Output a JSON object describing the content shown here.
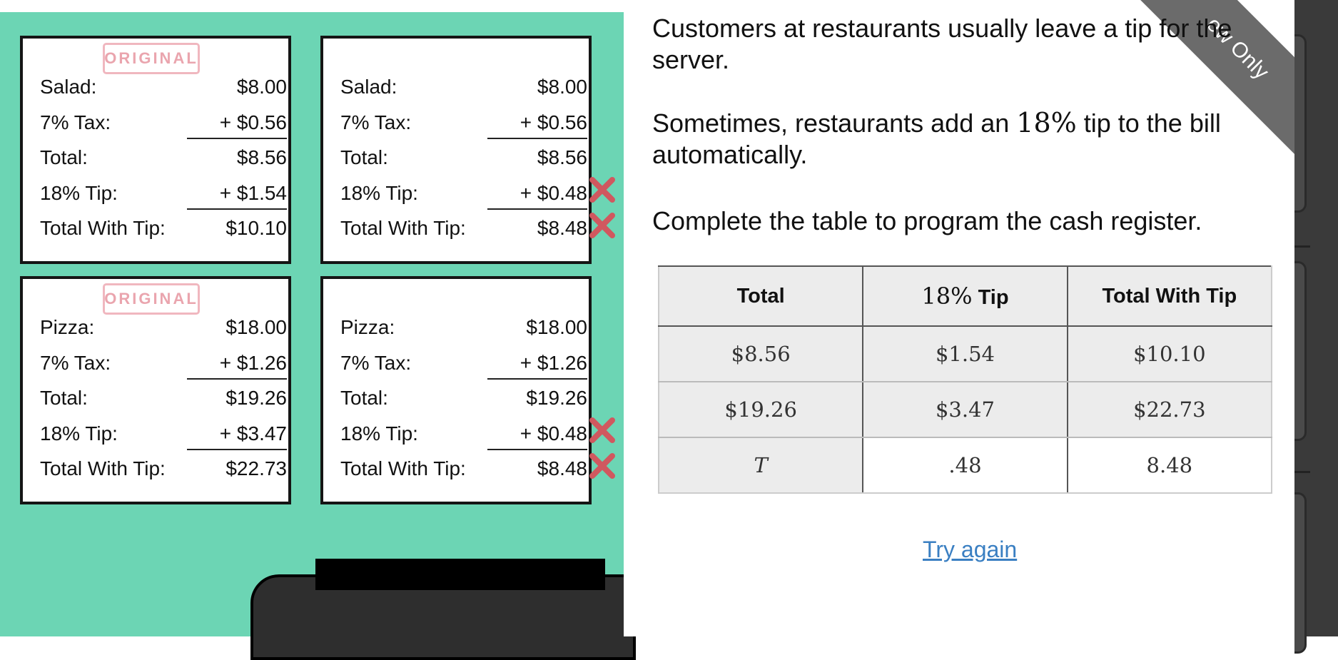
{
  "receipts": [
    {
      "stamp": "ORIGINAL",
      "rows": [
        {
          "label": "Salad:",
          "value": "$8.00"
        },
        {
          "label": "7% Tax:",
          "value": "+ $0.56"
        },
        {
          "label": "Total:",
          "value": "$8.56"
        },
        {
          "label": "18% Tip:",
          "value": "+ $1.54"
        },
        {
          "label": "Total With Tip:",
          "value": "$10.10"
        }
      ]
    },
    {
      "stamp": "",
      "rows": [
        {
          "label": "Salad:",
          "value": "$8.00"
        },
        {
          "label": "7% Tax:",
          "value": "+ $0.56"
        },
        {
          "label": "Total:",
          "value": "$8.56"
        },
        {
          "label": "18% Tip:",
          "value": "+ $0.48"
        },
        {
          "label": "Total With Tip:",
          "value": "$8.48"
        }
      ]
    },
    {
      "stamp": "ORIGINAL",
      "rows": [
        {
          "label": "Pizza:",
          "value": "$18.00"
        },
        {
          "label": "7% Tax:",
          "value": "+ $1.26"
        },
        {
          "label": "Total:",
          "value": "$19.26"
        },
        {
          "label": "18% Tip:",
          "value": "+ $3.47"
        },
        {
          "label": "Total With Tip:",
          "value": "$22.73"
        }
      ]
    },
    {
      "stamp": "",
      "rows": [
        {
          "label": "Pizza:",
          "value": "$18.00"
        },
        {
          "label": "7% Tax:",
          "value": "+ $1.26"
        },
        {
          "label": "Total:",
          "value": "$19.26"
        },
        {
          "label": "18% Tip:",
          "value": "+ $0.48"
        },
        {
          "label": "Total With Tip:",
          "value": "$8.48"
        }
      ]
    }
  ],
  "wrong_mark_color": "#d0585f",
  "ribbon": "ew Only",
  "paragraphs": {
    "p1": "Customers at restaurants usually leave a tip for the server.",
    "p2_before": "Sometimes, restaurants add an ",
    "p2_math": "18%",
    "p2_after": " tip to the bill automatically.",
    "p3": "Complete the table to program the cash register."
  },
  "table": {
    "headers": {
      "total": "Total",
      "tip_math": "18%",
      "tip_word": "Tip",
      "total_with_tip": "Total With Tip"
    },
    "rows": [
      [
        "$8.56",
        "$1.54",
        "$10.10"
      ],
      [
        "$19.26",
        "$3.47",
        "$22.73"
      ],
      [
        "T",
        ".48",
        "8.48"
      ]
    ]
  },
  "try_again": "Try again"
}
